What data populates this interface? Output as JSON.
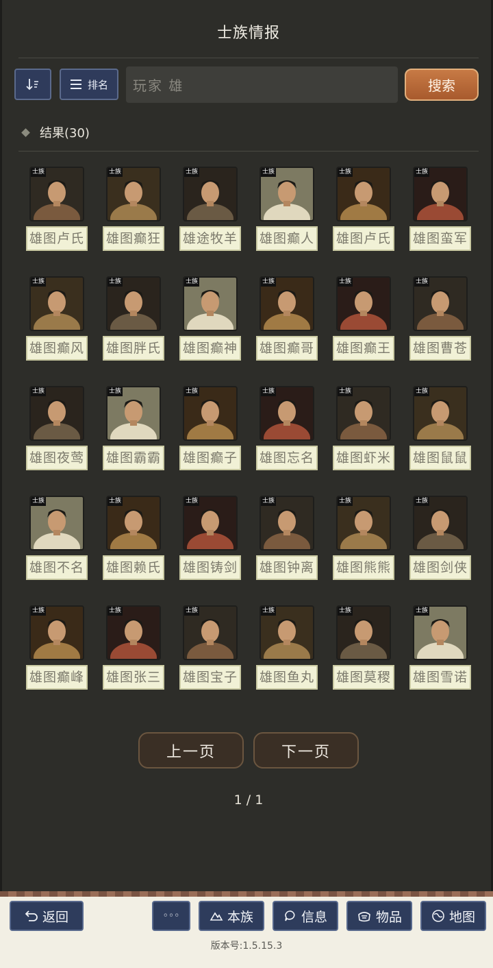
{
  "header": {
    "title": "士族情报"
  },
  "toolbar": {
    "sort_icon": "sort-order-icon",
    "rank_label": "排名",
    "search_value": "玩家  雄",
    "search_button": "搜索"
  },
  "results": {
    "label": "结果(30)",
    "tag": "士族",
    "items": [
      {
        "name": "雄图卢氏"
      },
      {
        "name": "雄图癫狂"
      },
      {
        "name": "雄途牧羊"
      },
      {
        "name": "雄图癫人"
      },
      {
        "name": "雄图卢氏"
      },
      {
        "name": "雄图蛮军"
      },
      {
        "name": "雄图癫风"
      },
      {
        "name": "雄图胖氏"
      },
      {
        "name": "雄图癫神"
      },
      {
        "name": "雄图癫哥"
      },
      {
        "name": "雄图癫王"
      },
      {
        "name": "雄图曹苍"
      },
      {
        "name": "雄图夜莺"
      },
      {
        "name": "雄图霸霸"
      },
      {
        "name": "雄图癫子"
      },
      {
        "name": "雄图忘名"
      },
      {
        "name": "雄图虾米"
      },
      {
        "name": "雄图鼠鼠"
      },
      {
        "name": "雄图不名"
      },
      {
        "name": "雄图赖氏"
      },
      {
        "name": "雄图铸剑"
      },
      {
        "name": "雄图钟离"
      },
      {
        "name": "雄图熊熊"
      },
      {
        "name": "雄图剑侠"
      },
      {
        "name": "雄图癫峰"
      },
      {
        "name": "雄图张三"
      },
      {
        "name": "雄图宝子"
      },
      {
        "name": "雄图鱼丸"
      },
      {
        "name": "雄图莫稷"
      },
      {
        "name": "雄图雪诺"
      }
    ]
  },
  "pagination": {
    "prev": "上一页",
    "next": "下一页",
    "page": "1 / 1"
  },
  "bottom_nav": {
    "back": "返回",
    "more": "◦◦◦",
    "clan": "本族",
    "info": "信息",
    "items": "物品",
    "map": "地图"
  },
  "version": "版本号:1.5.15.3",
  "colors": {
    "accent_orange": "#b8683a",
    "nav_blue": "#2e3c5c",
    "name_plate": "#f1f1d6"
  }
}
